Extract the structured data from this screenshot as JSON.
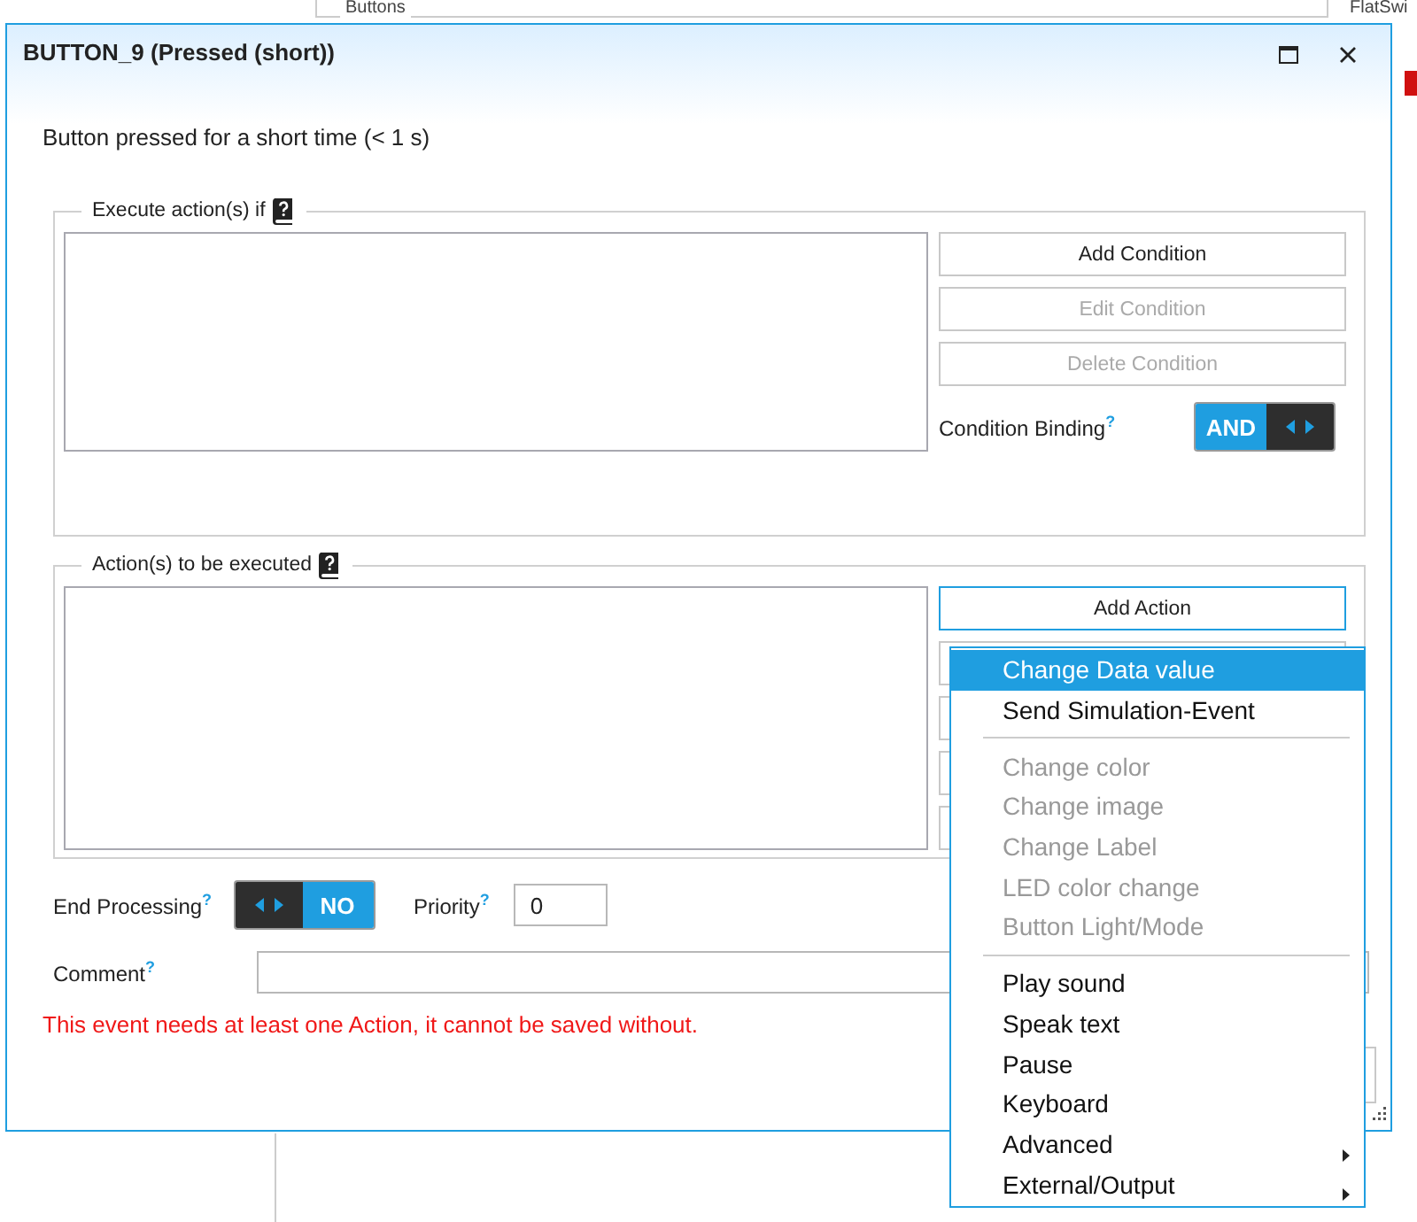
{
  "background": {
    "panel_label": "Buttons",
    "side_label": "FlatSwi"
  },
  "dialog": {
    "title": "BUTTON_9 (Pressed (short))",
    "description": "Button pressed for a short time (< 1 s)"
  },
  "conditions": {
    "legend": "Execute action(s) if",
    "buttons": [
      {
        "label": "Add Condition",
        "disabled": false
      },
      {
        "label": "Edit Condition",
        "disabled": true
      },
      {
        "label": "Delete Condition",
        "disabled": true
      }
    ],
    "binding_label": "Condition Binding",
    "binding_help": "?",
    "binding_value": "AND",
    "binding_on": true
  },
  "actions": {
    "legend": "Action(s) to be executed",
    "add_button": {
      "label": "Add Action",
      "focused": true
    }
  },
  "end_processing": {
    "label": "End Processing",
    "help": "?",
    "value": "NO",
    "on": false
  },
  "priority": {
    "label": "Priority",
    "help": "?",
    "value": "0"
  },
  "comment": {
    "label": "Comment",
    "help": "?"
  },
  "error": "This event needs at least one Action, it cannot be saved without.",
  "menu": [
    {
      "kind": "item",
      "label": "Change Data value",
      "selected": true,
      "disabled": false,
      "submenu": false
    },
    {
      "kind": "item",
      "label": "Send Simulation-Event",
      "selected": false,
      "disabled": false,
      "submenu": false
    },
    {
      "kind": "separator"
    },
    {
      "kind": "item",
      "label": "Change color",
      "selected": false,
      "disabled": true,
      "submenu": false
    },
    {
      "kind": "item",
      "label": "Change image",
      "selected": false,
      "disabled": true,
      "submenu": false
    },
    {
      "kind": "item",
      "label": "Change Label",
      "selected": false,
      "disabled": true,
      "submenu": false
    },
    {
      "kind": "item",
      "label": "LED color change",
      "selected": false,
      "disabled": true,
      "submenu": false
    },
    {
      "kind": "item",
      "label": "Button Light/Mode",
      "selected": false,
      "disabled": true,
      "submenu": false
    },
    {
      "kind": "separator"
    },
    {
      "kind": "item",
      "label": "Play sound",
      "selected": false,
      "disabled": false,
      "submenu": false
    },
    {
      "kind": "item",
      "label": "Speak text",
      "selected": false,
      "disabled": false,
      "submenu": false
    },
    {
      "kind": "item",
      "label": "Pause",
      "selected": false,
      "disabled": false,
      "submenu": false
    },
    {
      "kind": "item",
      "label": "Keyboard",
      "selected": false,
      "disabled": false,
      "submenu": false
    },
    {
      "kind": "item",
      "label": "Advanced",
      "selected": false,
      "disabled": false,
      "submenu": true
    },
    {
      "kind": "item",
      "label": "External/Output",
      "selected": false,
      "disabled": false,
      "submenu": true
    }
  ]
}
